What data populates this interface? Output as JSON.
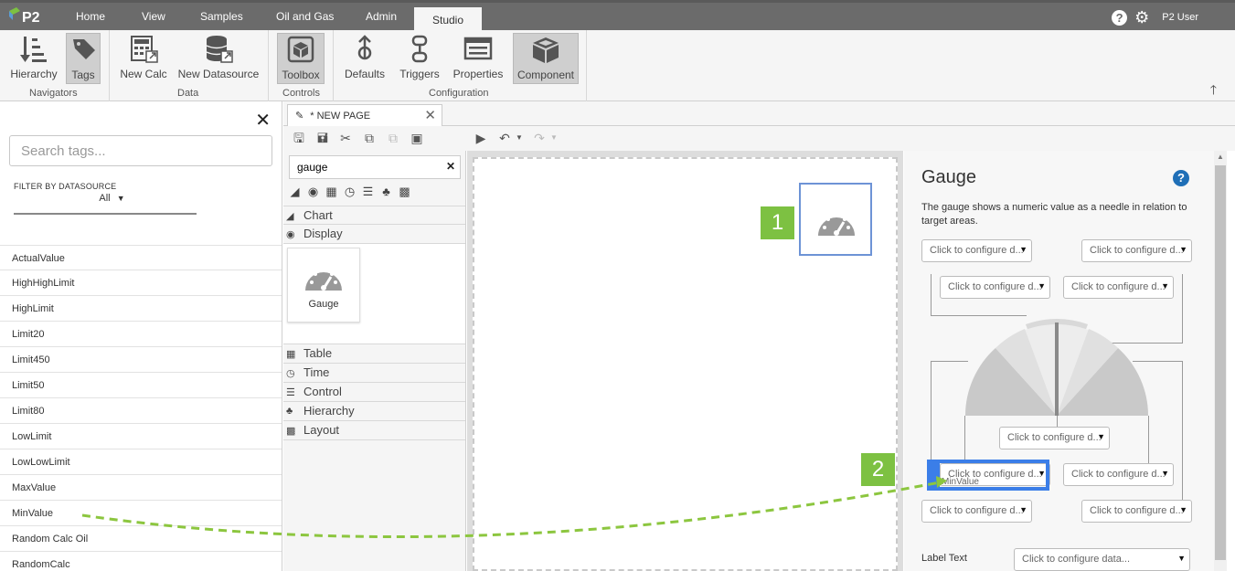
{
  "nav": {
    "logo_text": "P2",
    "tabs": [
      "Home",
      "View",
      "Samples",
      "Oil and Gas",
      "Admin",
      "Studio"
    ],
    "active_tab": "Studio",
    "user": "P2 User"
  },
  "ribbon": {
    "buttons": {
      "hierarchy": "Hierarchy",
      "tags": "Tags",
      "new_calc": "New Calc",
      "new_datasource": "New Datasource",
      "toolbox": "Toolbox",
      "defaults": "Defaults",
      "triggers": "Triggers",
      "properties": "Properties",
      "component": "Component"
    },
    "groups": {
      "navigators": "Navigators",
      "data": "Data",
      "controls": "Controls",
      "configuration": "Configuration"
    }
  },
  "tags_panel": {
    "search_placeholder": "Search tags...",
    "filter_label": "FILTER BY DATASOURCE",
    "filter_value": "All",
    "items": [
      "ActualValue",
      "HighHighLimit",
      "HighLimit",
      "Limit20",
      "Limit450",
      "Limit50",
      "Limit80",
      "LowLimit",
      "LowLowLimit",
      "MaxValue",
      "MinValue",
      "Random Calc Oil",
      "RandomCalc"
    ]
  },
  "page_tab": {
    "label": "* NEW PAGE"
  },
  "toolbox": {
    "search_value": "gauge",
    "categories": {
      "chart": "Chart",
      "display": "Display",
      "table": "Table",
      "time": "Time",
      "control": "Control",
      "hierarchy": "Hierarchy",
      "layout": "Layout"
    },
    "component_label": "Gauge"
  },
  "callouts": {
    "one": "1",
    "two": "2"
  },
  "config": {
    "title": "Gauge",
    "description": "The gauge shows a numeric value as a needle in relation to target areas.",
    "dropdown_text": "Click to configure d...",
    "label_text_label": "Label Text",
    "label_text_dropdown": "Click to configure data...",
    "drag_label": "MinValue"
  },
  "colors": {
    "nav_bg": "#6b6b6b",
    "callout": "#7dc142",
    "selection": "#3b7ee8",
    "drag_arrow": "#8cc63f",
    "help": "#1f6fb7"
  }
}
